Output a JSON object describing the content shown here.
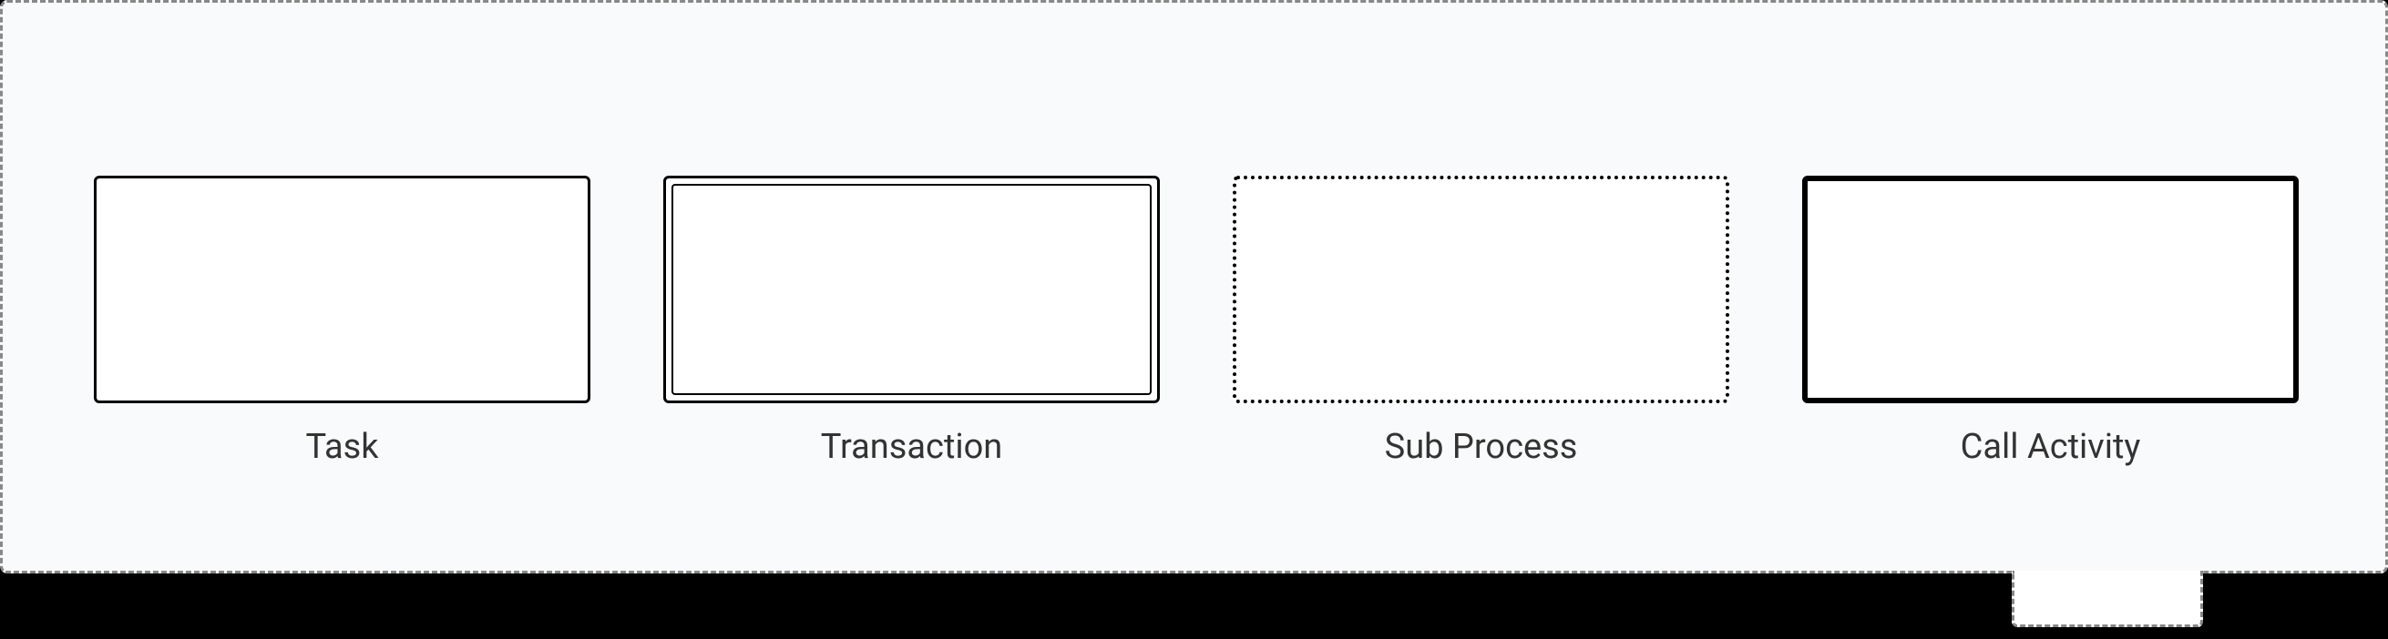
{
  "shapes": [
    {
      "label": "Task",
      "style": "task"
    },
    {
      "label": "Transaction",
      "style": "transaction"
    },
    {
      "label": "Sub Process",
      "style": "subprocess"
    },
    {
      "label": "Call Activity",
      "style": "callactivity"
    }
  ],
  "colors": {
    "containerBg": "#f9fafb",
    "border": "#000000",
    "dashBorder": "#888888",
    "text": "#333333"
  }
}
